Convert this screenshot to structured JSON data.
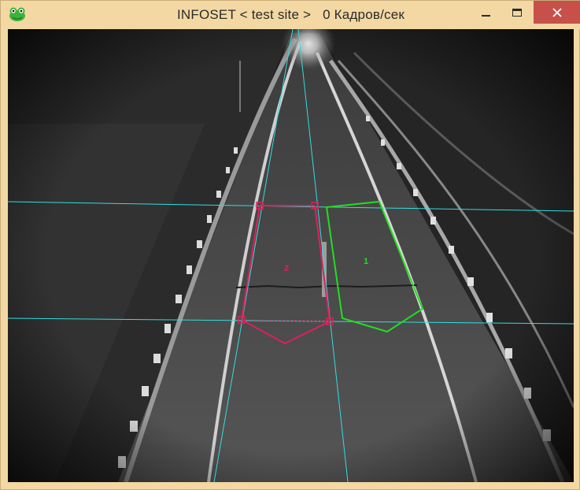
{
  "window": {
    "app_name": "INFOSET",
    "site": "< test site >",
    "fps": "0 Кадров/сек",
    "icon": "frog-icon",
    "controls": {
      "minimize": "minimize-icon",
      "maximize": "maximize-icon",
      "close": "close-icon"
    }
  },
  "camera": {
    "zones": [
      {
        "label": "1",
        "color": "#22dd22"
      },
      {
        "label": "2",
        "color": "#e0205a"
      }
    ],
    "calibration_line_color": "#33dde0"
  }
}
